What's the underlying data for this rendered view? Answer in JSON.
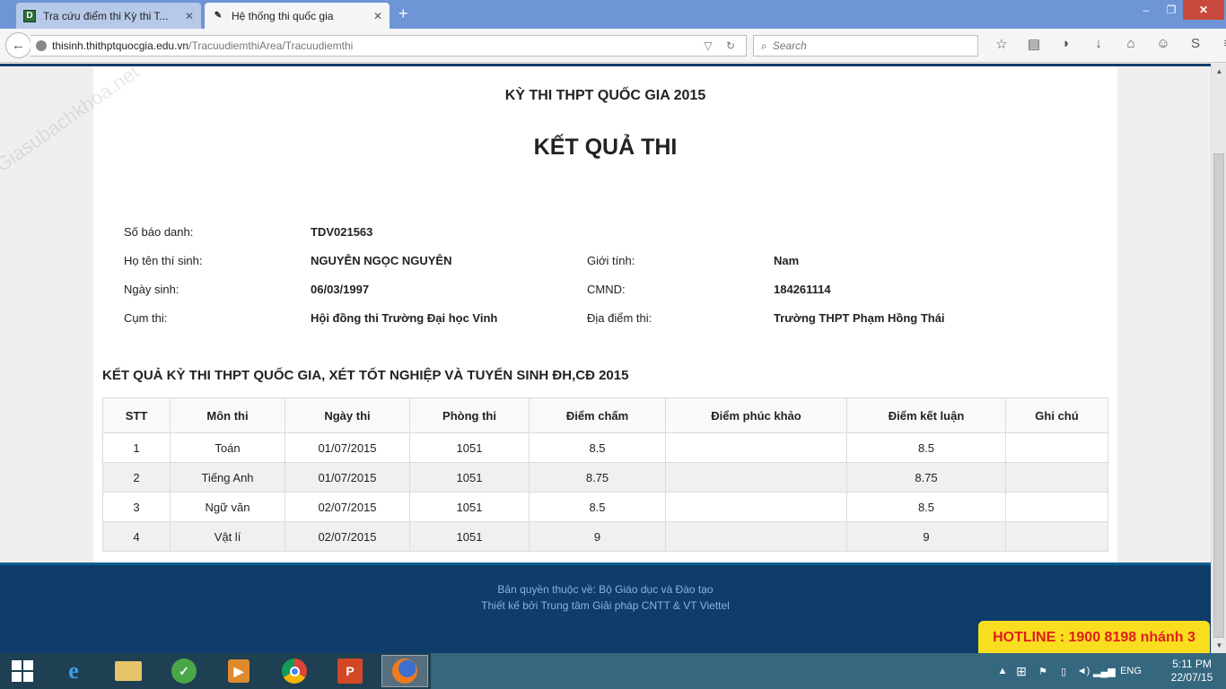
{
  "browser": {
    "tabs": [
      {
        "title": "Tra cứu điểm thi Kỳ thi T...",
        "icon": "D",
        "active": false
      },
      {
        "title": "Hệ thống thi quốc gia",
        "icon": "pencil",
        "active": true
      }
    ],
    "new_tab": "+",
    "url_host": "thisinh.thithptquocgia.edu.vn",
    "url_path": "/TracuudiemthiArea/Tracuudiemthi",
    "search_placeholder": "Search",
    "window_controls": {
      "minimize": "–",
      "maximize": "❐",
      "close": "✕"
    }
  },
  "page": {
    "exam_title": "KỲ THI THPT QUỐC GIA 2015",
    "result_title": "KẾT QUẢ THI",
    "info": {
      "sbd_label": "Số báo danh:",
      "sbd_value": "TDV021563",
      "name_label": "Họ tên thí sinh:",
      "name_value": "NGUYỄN NGỌC NGUYÊN",
      "gender_label": "Giới tính:",
      "gender_value": "Nam",
      "dob_label": "Ngày sinh:",
      "dob_value": "06/03/1997",
      "id_label": "CMND:",
      "id_value": "184261114",
      "cluster_label": "Cụm thi:",
      "cluster_value": "Hội đồng thi Trường Đại học Vinh",
      "location_label": "Địa điểm thi:",
      "location_value": "Trường THPT Phạm Hồng Thái"
    },
    "section_title": "KẾT QUẢ KỲ THI THPT QUỐC GIA, XÉT TỐT NGHIỆP VÀ TUYỂN SINH ĐH,CĐ 2015",
    "table": {
      "headers": [
        "STT",
        "Môn thi",
        "Ngày thi",
        "Phòng thi",
        "Điểm chấm",
        "Điểm phúc khảo",
        "Điểm kết luận",
        "Ghi chú"
      ],
      "rows": [
        [
          "1",
          "Toán",
          "01/07/2015",
          "1051",
          "8.5",
          "",
          "8.5",
          ""
        ],
        [
          "2",
          "Tiếng Anh",
          "01/07/2015",
          "1051",
          "8.75",
          "",
          "8.75",
          ""
        ],
        [
          "3",
          "Ngữ văn",
          "02/07/2015",
          "1051",
          "8.5",
          "",
          "8.5",
          ""
        ],
        [
          "4",
          "Vật lí",
          "02/07/2015",
          "1051",
          "9",
          "",
          "9",
          ""
        ]
      ]
    },
    "footer": {
      "copyright": "Bản quyền thuộc về: Bộ Giáo dục và Đào tạo",
      "designer": "Thiết kế bởi Trung tâm Giải pháp CNTT & VT Viettel"
    },
    "watermark": "Giasubachkhoa.net"
  },
  "hotline": "HOTLINE : 1900 8198 nhánh 3",
  "taskbar": {
    "language": "ENG",
    "time": "5:11 PM",
    "date": "22/07/15"
  }
}
